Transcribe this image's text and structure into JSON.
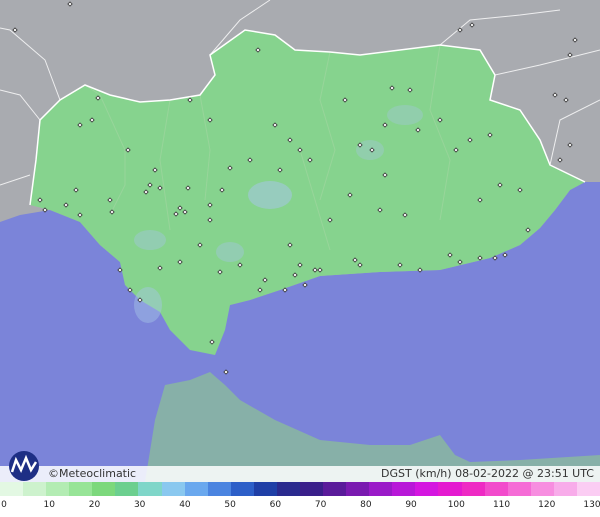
{
  "footer": {
    "brand": "©Meteoclimatic",
    "stamp": "DGST (km/h)   08-02-2022 @ 23:51 UTC"
  },
  "legend": {
    "ticks": [
      "0",
      "10",
      "20",
      "30",
      "40",
      "50",
      "60",
      "70",
      "80",
      "90",
      "100",
      "110",
      "120",
      "130"
    ],
    "colors": [
      "#e3f8e3",
      "#cdf2cd",
      "#b3ecb3",
      "#97e497",
      "#7cd87c",
      "#6ccf8f",
      "#7fd6c9",
      "#8ac8ef",
      "#6aa8ee",
      "#4b84e0",
      "#2d5fc8",
      "#1f3fa6",
      "#2a2a8e",
      "#3a1f8a",
      "#5a1b9a",
      "#7a1ab0",
      "#9a1ac8",
      "#b818d8",
      "#d416e0",
      "#e41ad0",
      "#ee2ac4",
      "#f24bcc",
      "#f56cd6",
      "#f78ee0",
      "#f8acea",
      "#fbcdf3"
    ]
  },
  "colors": {
    "sea": "#7b84d9",
    "land_region": "#86d38e",
    "land_outside": "#a7a9ad",
    "morocco": "#87b0a8"
  }
}
